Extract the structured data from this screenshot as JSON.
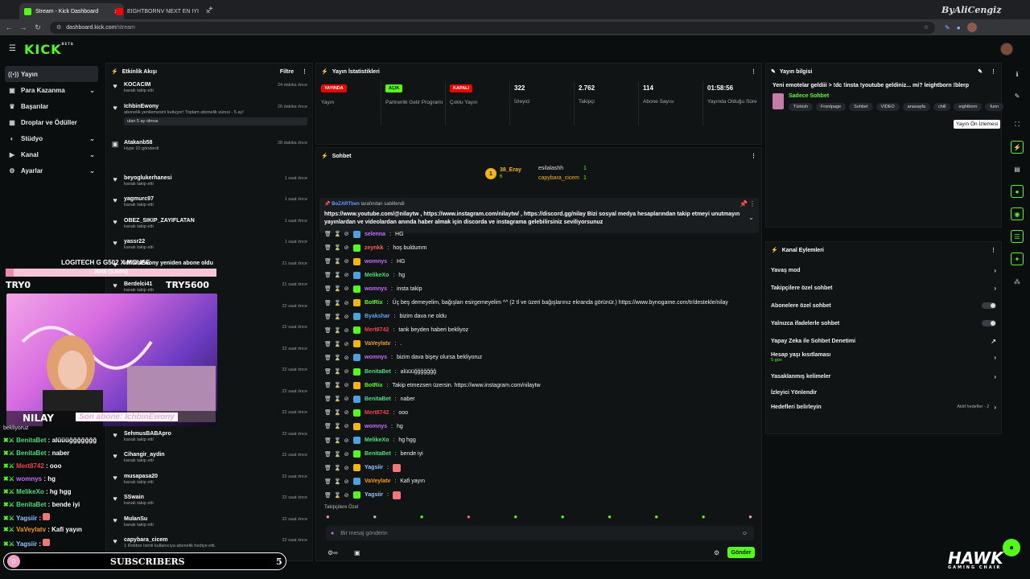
{
  "browser": {
    "tabs": [
      {
        "title": "Stream - Kick Dashboard"
      },
      {
        "title": "EIGHTBORNV NEXT EN İYİ ANI..."
      }
    ],
    "url_host": "dashboard.kick.com",
    "url_path": "/stream"
  },
  "app": {
    "logo": "KICK",
    "logo_sub": "BETA"
  },
  "nav": {
    "items": [
      {
        "label": "Yayın",
        "icon": "stream-icon",
        "active": true
      },
      {
        "label": "Para Kazanma",
        "icon": "money-icon"
      },
      {
        "label": "Başarılar",
        "icon": "trophy-icon"
      },
      {
        "label": "Droplar ve Ödüller",
        "icon": "gift-icon"
      },
      {
        "label": "Stüdyo",
        "icon": "studio-icon"
      },
      {
        "label": "Kanal",
        "icon": "channel-icon"
      },
      {
        "label": "Ayarlar",
        "icon": "gear-icon"
      }
    ]
  },
  "activity": {
    "title": "Etkinlik Akışı",
    "filter": "Filtre",
    "items": [
      {
        "name": "KOCACIM",
        "sub": "kanalı takip etti",
        "time": "24 dakika önce"
      },
      {
        "name": "IchbinEwony",
        "sub": "abonelik yenilemesini kutluyor! Toplam abonelik süresi - 5 ay!",
        "time": "26 dakika önce",
        "message": "ulan 5 ay olmus"
      },
      {
        "name": "Atakanb58",
        "sub": "Hype 10 gönderdi",
        "time": "28 dakika önce"
      },
      {
        "name": "beyoglukerhanesi",
        "sub": "kanalı takip etti",
        "time": "1 saat önce"
      },
      {
        "name": "yagmurc97",
        "sub": "kanalı takip etti",
        "time": "1 saat önce"
      },
      {
        "name": "OBEZ_SIKIP_ZAYIFLATAN",
        "sub": "kanalı takip etti",
        "time": "1 saat önce"
      },
      {
        "name": "yassr22",
        "sub": "kanalı takip etti",
        "time": "1 saat önce"
      },
      {
        "name": "IchbinEwony yeniden abone oldu",
        "sub": "",
        "time": "21 saat önce"
      },
      {
        "name": "Berdelci41",
        "sub": "kanalı takip etti",
        "time": "21 saat önce"
      },
      {
        "name": "",
        "sub": "",
        "time": "22 saat önce"
      },
      {
        "name": "",
        "sub": "",
        "time": "22 saat önce"
      },
      {
        "name": "",
        "sub": "",
        "time": "22 saat önce"
      },
      {
        "name": "",
        "sub": "",
        "time": "22 saat önce"
      },
      {
        "name": "",
        "sub": "",
        "time": "22 saat önce"
      },
      {
        "name": "",
        "sub": "",
        "time": "22 saat önce"
      },
      {
        "name": "SehmusBABApro",
        "sub": "kanalı takip etti",
        "time": "22 saat önce"
      },
      {
        "name": "Cihangir_aydin",
        "sub": "kanalı takip etti",
        "time": "22 saat önce"
      },
      {
        "name": "musapasa20",
        "sub": "kanalı takip etti",
        "time": "22 saat önce"
      },
      {
        "name": "SSwain",
        "sub": "kanalı takip etti",
        "time": "22 saat önce"
      },
      {
        "name": "MulanSu",
        "sub": "kanalı takip etti",
        "time": "22 saat önce"
      },
      {
        "name": "capybara_cicem",
        "sub": "1 Robbor isimli kullanıcıya abonelik hediye etti.",
        "time": "22 saat önce"
      }
    ]
  },
  "stats": {
    "title": "Yayın İstatistikleri",
    "items": [
      {
        "value": "YAYINDA",
        "label": "Yayın",
        "pill": true,
        "pill_color": "#eb0400"
      },
      {
        "value": "AÇIK",
        "label": "Partnerlik Gelir Programı",
        "pill": true,
        "pill_color": "#53fc18"
      },
      {
        "value": "KAPALI",
        "label": "Çoklu Yayın",
        "pill": true,
        "pill_color": "#eb0400"
      },
      {
        "value": "322",
        "label": "İzleyici"
      },
      {
        "value": "2.762",
        "label": "Takipçi"
      },
      {
        "value": "114",
        "label": "Abone Sayısı"
      },
      {
        "value": "01:58:56",
        "label": "Yayında Olduğu Süre"
      }
    ]
  },
  "chat": {
    "title": "Sohbet",
    "top_gifters": [
      {
        "name": "38_Eray",
        "count": "6"
      },
      {
        "name": "esilalashh",
        "count": "1"
      },
      {
        "name": "capybara_cicem",
        "count": "1"
      }
    ],
    "pinned_by": "BoZARTben",
    "pinned_suffix": "tarafından sabitlendi",
    "pinned_text": "https://www.youtube.com/@nilaytw , https://www.instagram.com/nilaytw/ , https://discord.gg/nilay Bizi sosyal medya hesaplarından takip etmeyi unutmayın yayınlardan ve videolardan anında haber almak için discorda ve instagrama gelebilirsiniz seviliyorsunuz",
    "messages": [
      {
        "user": "selenna",
        "text": "HG",
        "color": "#c86bff"
      },
      {
        "user": "zeynkk",
        "text": "hoş buldumm",
        "color": "#ff5a5a"
      },
      {
        "user": "womnys",
        "text": "HG",
        "color": "#c86bff"
      },
      {
        "user": "MelikeXo",
        "text": "hg",
        "color": "#4ade80"
      },
      {
        "user": "womnys",
        "text": "insta takip",
        "color": "#c86bff"
      },
      {
        "user": "BotRix",
        "text": "Üç beş demeyelim, bağışları esirgemeyelim ^^ (2 tl ve üzeri bağışlarınız ekranda görünür.) https://www.bynogame.com/tr/destekle/nilay",
        "color": "#53fc18"
      },
      {
        "user": "Byakshar",
        "text": "bizim dava ne oldu",
        "color": "#60a5fa"
      },
      {
        "user": "Mert8742",
        "text": "tank beyden haberi bekliyoz",
        "color": "#ef4444"
      },
      {
        "user": "VaVeylatv",
        "text": ".",
        "color": "#f59e0b"
      },
      {
        "user": "womnys",
        "text": "bizim dava bişey olursa bekliyoruz",
        "color": "#c86bff"
      },
      {
        "user": "BenitaBet",
        "text": "alüüüğğğğğğğ",
        "color": "#4ade80"
      },
      {
        "user": "BotRix",
        "text": "Takip etmezsen üzersin. https://www.instagram.com/nilaytw",
        "color": "#53fc18"
      },
      {
        "user": "BenitaBet",
        "text": "naber",
        "color": "#4ade80"
      },
      {
        "user": "Mert8742",
        "text": "ooo",
        "color": "#ef4444"
      },
      {
        "user": "womnys",
        "text": "hg",
        "color": "#c86bff"
      },
      {
        "user": "MelikeXo",
        "text": "hg hgg",
        "color": "#4ade80"
      },
      {
        "user": "BenitaBet",
        "text": "bende iyi",
        "color": "#4ade80"
      },
      {
        "user": "Yagsiir",
        "text": "",
        "color": "#93c5fd"
      },
      {
        "user": "VaVeylatv",
        "text": "Kafi yayın",
        "color": "#f59e0b"
      },
      {
        "user": "Yagsiir",
        "text": "",
        "color": "#93c5fd"
      }
    ],
    "followers_only_label": "Takipçilere Özel",
    "input_placeholder": "Bir mesaj gönderin",
    "send_label": "Gönder"
  },
  "stream_info": {
    "title": "Yayın bilgisi",
    "stream_title": "Yeni emotelar geldiii > !dc !insta !youtube geldiniz... mi? leightborn !blerp",
    "category": "Sadece Sohbet",
    "tags": [
      "Türkish",
      "Frontpage",
      "Sohbet",
      "VIDEO",
      "anasayfa",
      "chill",
      "eightborn",
      "funn"
    ],
    "tooltip": "Yayın Ön İzlemesi"
  },
  "channel_actions": {
    "title": "Kanal Eylemleri",
    "items": [
      {
        "label": "Yavaş mod",
        "end": "chevron"
      },
      {
        "label": "Takipçilere özel sohbet",
        "end": "chevron"
      },
      {
        "label": "Abonelere özel sohbet",
        "end": "toggle"
      },
      {
        "label": "Yalnızca ifadelerle sohbet",
        "end": "toggle"
      },
      {
        "label": "Yapay Zeka ile Sohbet Denetimi",
        "end": "chart"
      },
      {
        "label": "Hesap yaşı kısıtlaması",
        "sub": "5 gün",
        "end": "chevron"
      },
      {
        "label": "Yasaklanmış kelimeler",
        "end": "chevron"
      },
      {
        "label": "İzleyici Yönlendir",
        "end": ""
      },
      {
        "label": "Hedefleri belirleyin",
        "status": "Aktif hedefler - 2",
        "end": "chevron"
      }
    ]
  },
  "overlay": {
    "goal_title": "LOGITECH G G502 X MOUSE",
    "goal_progress": "2046 (3.64%)",
    "goal_fraction": 0.0364,
    "goal_left": "TRY0",
    "goal_right": "TRY5600",
    "streamer_name": "NILAY",
    "last_sub": "Son abone: IchbinEwony",
    "chat_partial": "bekliyoruz",
    "chat": [
      {
        "user": "BenitaBet",
        "text": "alüüüğğğğğğğ",
        "color": "#4ade80"
      },
      {
        "user": "BenitaBet",
        "text": "naber",
        "color": "#4ade80"
      },
      {
        "user": "Mert8742",
        "text": "ooo",
        "color": "#ef4444"
      },
      {
        "user": "womnys",
        "text": "hg",
        "color": "#c86bff"
      },
      {
        "user": "MelikeXo",
        "text": "hg hgg",
        "color": "#4ade80"
      },
      {
        "user": "BenitaBet",
        "text": "bende iyi",
        "color": "#4ade80"
      },
      {
        "user": "Yagsiir",
        "text": "",
        "color": "#93c5fd"
      },
      {
        "user": "VaVeylatv",
        "text": "Kafi yayın",
        "color": "#f59e0b"
      },
      {
        "user": "Yagsiir",
        "text": "",
        "color": "#93c5fd"
      }
    ],
    "subs_label": "SUBSCRIBERS",
    "subs_count": "5",
    "subs_start": "0"
  },
  "watermark": {
    "text": "HAWK",
    "sub": "GAMING CHAIR"
  },
  "corner_logo": "ByAliCengiz"
}
